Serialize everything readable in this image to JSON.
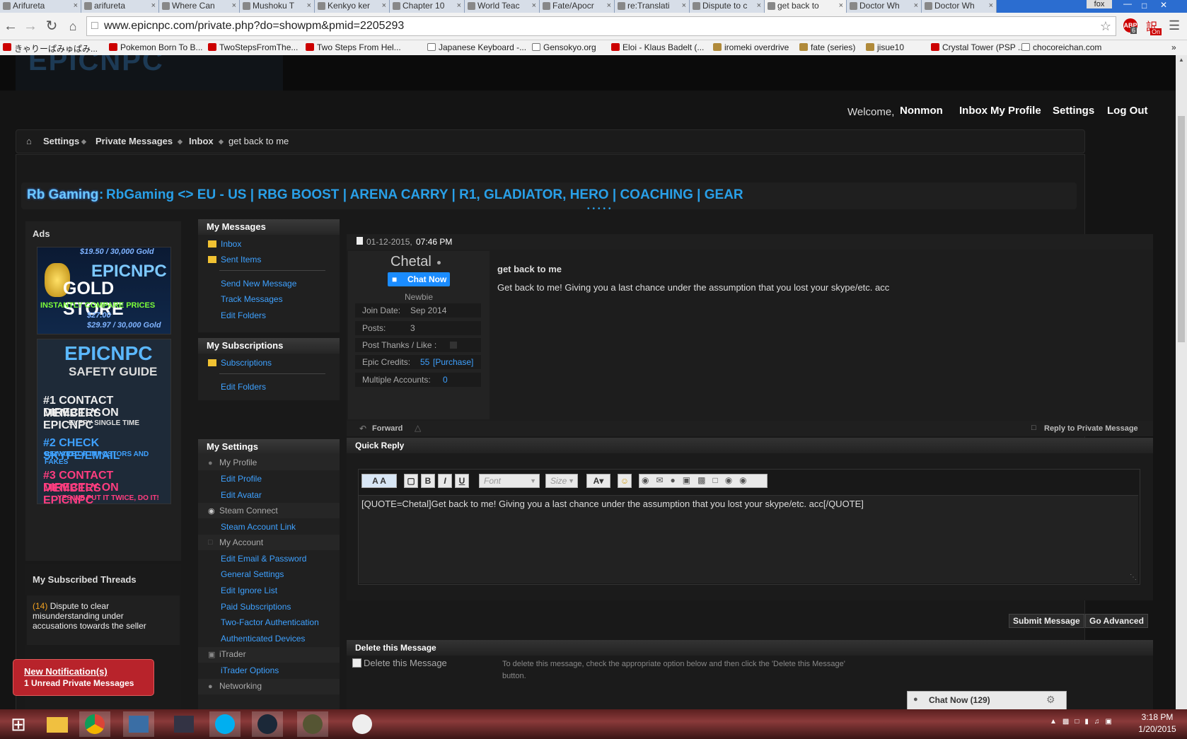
{
  "browser": {
    "tabs": [
      {
        "label": "Arifureta"
      },
      {
        "label": "arifureta"
      },
      {
        "label": "Where Can"
      },
      {
        "label": "Mushoku T"
      },
      {
        "label": "Kenkyo ker"
      },
      {
        "label": "Chapter 10"
      },
      {
        "label": "World Teac"
      },
      {
        "label": "Fate/Apocr"
      },
      {
        "label": "re:Translati"
      },
      {
        "label": "Dispute to c"
      },
      {
        "label": "get back to"
      },
      {
        "label": "Doctor Wh"
      },
      {
        "label": "Doctor Wh"
      }
    ],
    "profile": "fox",
    "url": "www.epicnpc.com/private.php?do=showpm&pmid=2205293",
    "ext_badge_1": "6",
    "ext_badge_2": "On",
    "bookmarks": [
      {
        "label": "きゃりーぱみゅぱみ..."
      },
      {
        "label": "Pokemon Born To B..."
      },
      {
        "label": "TwoStepsFromThe..."
      },
      {
        "label": "Two Steps From Hel..."
      },
      {
        "label": "Japanese Keyboard -..."
      },
      {
        "label": "Gensokyo.org"
      },
      {
        "label": "Eloi - Klaus Badelt (..."
      },
      {
        "label": "iromeki overdrive"
      },
      {
        "label": "fate (series)"
      },
      {
        "label": "jisue10"
      },
      {
        "label": "Crystal Tower (PSP ..."
      },
      {
        "label": "chocoreichan.com"
      }
    ]
  },
  "header": {
    "welcome": "Welcome,",
    "username": "Nonmon",
    "nav": [
      "Inbox",
      "My Profile",
      "Settings",
      "Log Out"
    ]
  },
  "breadcrumb": [
    "Settings",
    "Private Messages",
    "Inbox",
    "get back to me"
  ],
  "ad_banner": {
    "prefix": "Rb Gaming",
    "colon": ":",
    "text": "RbGaming <> EU - US | RBG BOOST | ARENA CARRY | R1, GLADIATOR, HERO | COACHING | GEAR"
  },
  "ads": {
    "title": "Ads",
    "gold_store": {
      "top_prices": "$19.50 / 30,000 Gold",
      "line1": "EPICNPC",
      "line2": "GOLD STORE",
      "line3": "INSTANTLY COMPARE PRICES",
      "bottom_prices": "$27.00",
      "bottom_price2": "$29.97 / 30,000 Gold"
    },
    "safety": {
      "line1": "EPICNPC",
      "line2": "SAFETY GUIDE",
      "r1a": "#1 CONTACT MEMBERS",
      "r1b": "DIRECTLY ON EPICNPC",
      "r1c": "EVERY SINGLE TIME",
      "r2a": "#2 CHECK SKYPE/EMAIL",
      "r2b": "BEWARE OF IMPOSTORS AND FAKES",
      "r3a": "#3 CONTACT MEMBERS",
      "r3b": "DIRECTLY ON EPICNPC",
      "r3c": "YES WE PUT IT TWICE, DO IT!"
    },
    "subscribed_title": "My Subscribed Threads",
    "thread_count": "(14)",
    "thread_title": "Dispute to clear misunderstanding under accusations towards the seller"
  },
  "notification": {
    "title": "New Notification(s)",
    "detail": "1 Unread Private Messages"
  },
  "sidebar": {
    "messages_title": "My Messages",
    "inbox": "Inbox",
    "sent": "Sent Items",
    "send_new": "Send New Message",
    "track": "Track Messages",
    "edit_folders": "Edit Folders",
    "subs_title": "My Subscriptions",
    "subscriptions": "Subscriptions",
    "subs_edit_folders": "Edit Folders",
    "settings_title": "My Settings",
    "my_profile": "My Profile",
    "edit_profile": "Edit Profile",
    "edit_avatar": "Edit Avatar",
    "steam_connect": "Steam Connect",
    "steam_link": "Steam Account Link",
    "my_account": "My Account",
    "edit_email": "Edit Email & Password",
    "general_settings": "General Settings",
    "edit_ignore": "Edit Ignore List",
    "paid_subs": "Paid Subscriptions",
    "two_factor": "Two-Factor Authentication",
    "auth_devices": "Authenticated Devices",
    "itrader": "iTrader",
    "itrader_options": "iTrader Options",
    "networking": "Networking"
  },
  "message": {
    "date": "01-12-2015,",
    "time": "07:46 PM",
    "sender": "Chetal",
    "chat_now": "Chat Now",
    "rank": "Newbie",
    "join_label": "Join Date:",
    "join_value": "Sep 2014",
    "posts_label": "Posts:",
    "posts_value": "3",
    "thanks_label": "Post Thanks / Like :",
    "credits_label": "Epic Credits:",
    "credits_value": "55",
    "credits_purchase": "[Purchase]",
    "multi_label": "Multiple Accounts:",
    "multi_value": "0",
    "subject": "get back to me",
    "body": "Get back to me! Giving you a last chance under the assumption that you lost your skype/etc. acc",
    "forward": "Forward",
    "reply": "Reply to Private Message"
  },
  "quick_reply": {
    "title": "Quick Reply",
    "font_placeholder": "Font",
    "size_placeholder": "Size",
    "text": "[QUOTE=Chetal]Get back to me! Giving you a last chance under the assumption that you lost your skype/etc. acc[/QUOTE]",
    "submit": "Submit Message",
    "advanced": "Go Advanced"
  },
  "delete": {
    "title": "Delete this Message",
    "checkbox": "Delete this Message",
    "help": "To delete this message, check the appropriate option below and then click the 'Delete this Message' button."
  },
  "chat_bar": {
    "label": "Chat Now (129)"
  },
  "taskbar": {
    "time": "3:18 PM",
    "date": "1/20/2015"
  }
}
